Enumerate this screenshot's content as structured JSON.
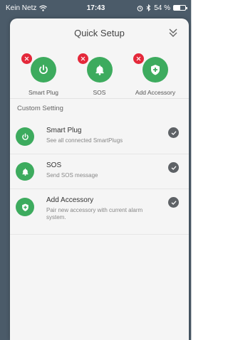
{
  "status_bar": {
    "carrier": "Kein Netz",
    "time": "17:43",
    "battery_percent_text": "54 %",
    "battery_level": 0.54,
    "icons": [
      "wifi-icon",
      "alarm-icon",
      "bluetooth-icon",
      "battery-icon"
    ]
  },
  "sheet": {
    "title": "Quick Setup",
    "collapse_icon": "double-chevron-down-icon"
  },
  "quick_items": [
    {
      "label": "Smart Plug",
      "icon": "power-icon"
    },
    {
      "label": "SOS",
      "icon": "bell-icon"
    },
    {
      "label": "Add Accessory",
      "icon": "shield-plus-icon"
    }
  ],
  "section": {
    "label": "Custom Setting"
  },
  "custom_items": [
    {
      "title": "Smart Plug",
      "subtitle": "See all connected SmartPlugs",
      "icon": "power-icon"
    },
    {
      "title": "SOS",
      "subtitle": "Send SOS message",
      "icon": "bell-icon"
    },
    {
      "title": "Add Accessory",
      "subtitle": "Pair new accessory with current alarm system.",
      "icon": "shield-plus-icon"
    }
  ],
  "colors": {
    "accent_green": "#3dab5e",
    "badge_red": "#e4283a",
    "check_gray": "#5e6266",
    "backdrop": "#4b5b69"
  }
}
